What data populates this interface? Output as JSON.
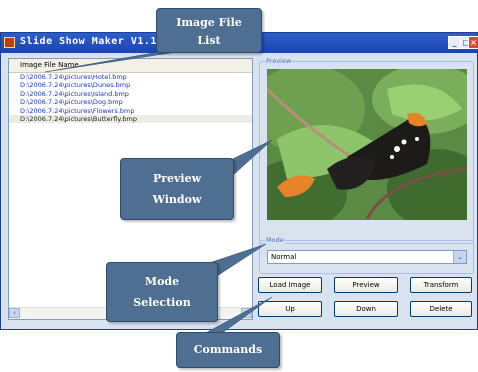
{
  "window": {
    "title": "Slide Show Maker V1.12",
    "min_label": "_",
    "max_label": "□",
    "close_label": "×"
  },
  "file_list": {
    "header": "Image File Name",
    "rows": [
      "D:\\2006.7.24\\pictures\\Hotel.bmp",
      "D:\\2006.7.24\\pictures\\Dunes.bmp",
      "D:\\2006.7.24\\pictures\\Island.bmp",
      "D:\\2006.7.24\\pictures\\Dog.bmp",
      "D:\\2006.7.24\\pictures\\Flowers.bmp",
      "D:\\2006.7.24\\pictures\\Butterfly.bmp"
    ],
    "selected_index": 5,
    "scroll_left": "‹",
    "scroll_right": "›"
  },
  "preview": {
    "group_label": "Preview"
  },
  "mode": {
    "group_label": "Mode",
    "selected": "Normal",
    "arrow": "⌄"
  },
  "buttons": {
    "load_image": "Load Image",
    "preview": "Preview",
    "transform": "Transform",
    "up": "Up",
    "down": "Down",
    "delete": "Delete"
  },
  "callouts": {
    "image_file_list_1": "Image File",
    "image_file_list_2": "List",
    "preview_window_1": "Preview",
    "preview_window_2": "Window",
    "mode_selection_1": "Mode",
    "mode_selection_2": "Selection",
    "commands": "Commands"
  },
  "colors": {
    "titlebar": "#1a45b0",
    "window_bg": "#d9e3f0",
    "callout_bg": "#4f6f92",
    "list_text": "#1a35c9"
  }
}
